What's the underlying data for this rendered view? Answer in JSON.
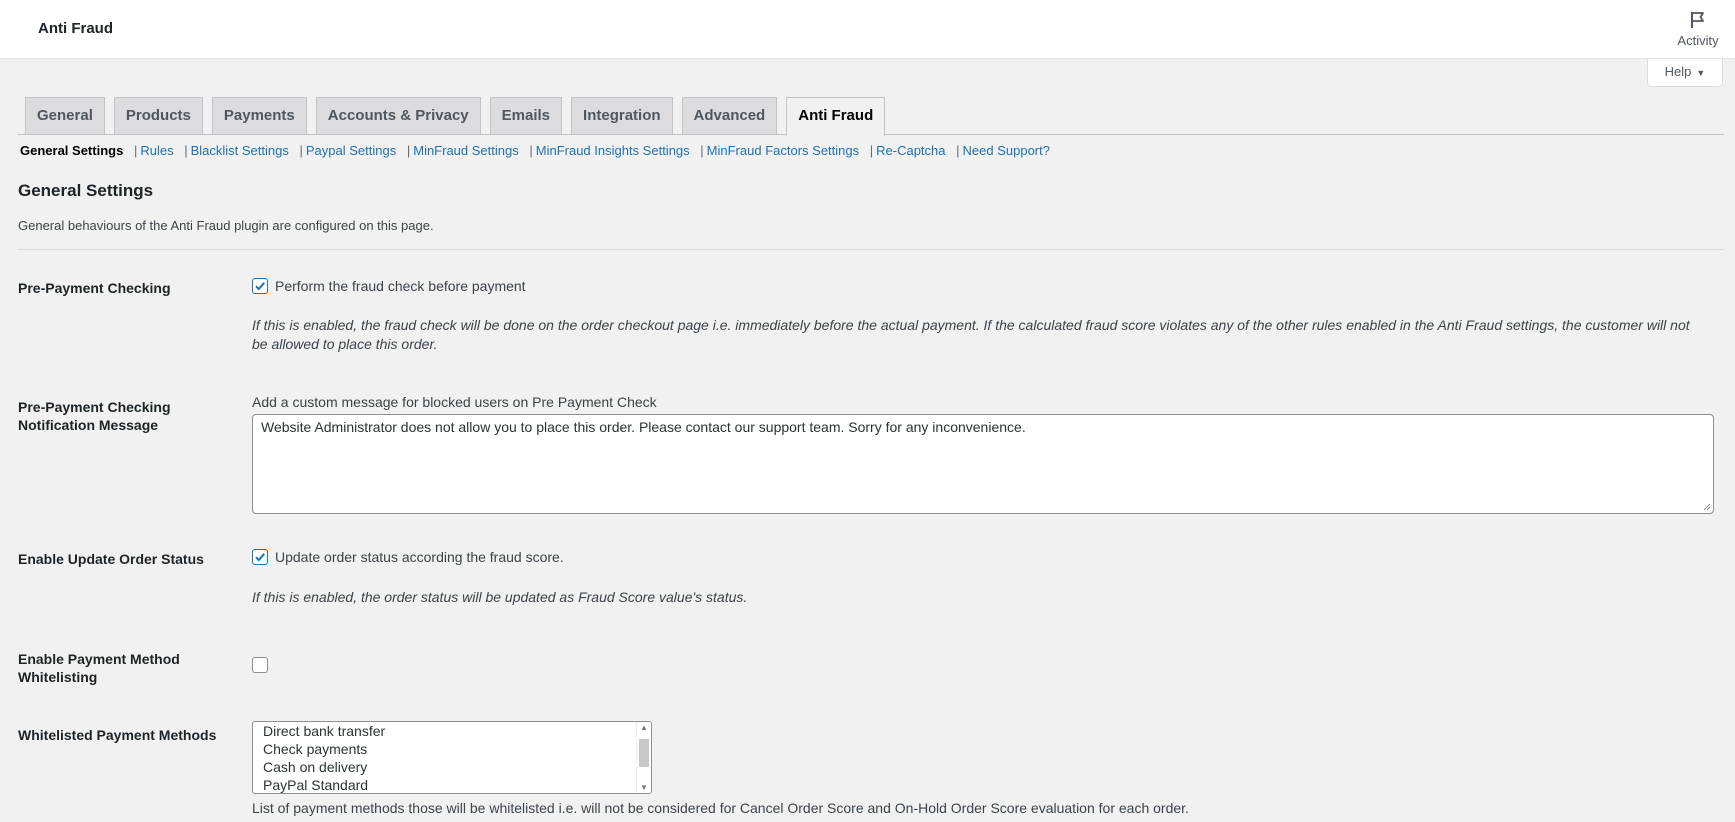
{
  "topbar": {
    "title": "Anti Fraud",
    "activity_label": "Activity"
  },
  "help": {
    "label": "Help"
  },
  "tabs": [
    {
      "label": "General",
      "active": false
    },
    {
      "label": "Products",
      "active": false
    },
    {
      "label": "Payments",
      "active": false
    },
    {
      "label": "Accounts & Privacy",
      "active": false
    },
    {
      "label": "Emails",
      "active": false
    },
    {
      "label": "Integration",
      "active": false
    },
    {
      "label": "Advanced",
      "active": false
    },
    {
      "label": "Anti Fraud",
      "active": true
    }
  ],
  "subnav": {
    "current": "General Settings",
    "separator": "|",
    "links": [
      "Rules",
      "Blacklist Settings",
      "Paypal Settings",
      "MinFraud Settings",
      "MinFraud Insights Settings",
      "MinFraud Factors Settings",
      "Re-Captcha",
      "Need Support?"
    ]
  },
  "section": {
    "title": "General Settings",
    "description": "General behaviours of the Anti Fraud plugin are configured on this page."
  },
  "pre_payment": {
    "label": "Pre-Payment Checking",
    "checkbox_label": "Perform the fraud check before payment",
    "checked": true,
    "description": "If this is enabled, the fraud check will be done on the order checkout page i.e. immediately before the actual payment. If the calculated fraud score violates any of the other rules enabled in the Anti Fraud settings, the customer will not be allowed to place this order."
  },
  "notification": {
    "label_line1": "Pre-Payment Checking",
    "label_line2": "Notification Message",
    "hint": "Add a custom message for blocked users on Pre Payment Check",
    "value": "Website Administrator does not allow you to place this order. Please contact our support team. Sorry for any inconvenience."
  },
  "update_status": {
    "label": "Enable Update Order Status",
    "checkbox_label": "Update order status according the fraud score.",
    "checked": true,
    "description": "If this is enabled, the order status will be updated as Fraud Score value's status."
  },
  "whitelisting": {
    "label_line1": "Enable Payment Method",
    "label_line2": "Whitelisting",
    "checked": false
  },
  "whitelisted_methods": {
    "label": "Whitelisted Payment Methods",
    "options": [
      "Direct bank transfer",
      "Check payments",
      "Cash on delivery",
      "PayPal Standard"
    ],
    "description": "List of payment methods those will be whitelisted i.e. will not be considered for Cancel Order Score and On-Hold Order Score evaluation for each order."
  },
  "colors": {
    "accent": "#2271b1",
    "background": "#f1f1f1",
    "text": "#1d2327"
  },
  "icons": {
    "activity": "flag-icon",
    "help": "caret-down-icon",
    "checkbox": "checkmark-icon"
  }
}
